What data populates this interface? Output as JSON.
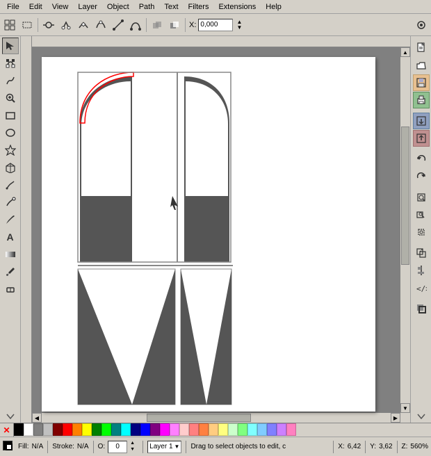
{
  "menubar": {
    "items": [
      "File",
      "Edit",
      "View",
      "Layer",
      "Object",
      "Path",
      "Text",
      "Filters",
      "Extensions",
      "Help"
    ]
  },
  "toolbar": {
    "x_label": "X:",
    "x_value": "0,000",
    "icons": [
      "select-all",
      "rubber-band",
      "node-join",
      "node-break",
      "node-cusp",
      "node-smooth",
      "node-symmetric",
      "node-auto-smooth",
      "segment-line",
      "segment-curve",
      "path-union",
      "path-difference"
    ],
    "snap_icons": [
      "snap-to-grid",
      "snap-enable"
    ]
  },
  "toolbox": {
    "tools": [
      {
        "name": "selector",
        "icon": "↖",
        "active": true
      },
      {
        "name": "node-editor",
        "icon": "⬡"
      },
      {
        "name": "tweak",
        "icon": "~"
      },
      {
        "name": "zoom",
        "icon": "🔍"
      },
      {
        "name": "rect",
        "icon": "▭"
      },
      {
        "name": "ellipse",
        "icon": "⬭"
      },
      {
        "name": "star",
        "icon": "★"
      },
      {
        "name": "3d-box",
        "icon": "◱"
      },
      {
        "name": "pencil",
        "icon": "✏"
      },
      {
        "name": "pen",
        "icon": "🖊"
      },
      {
        "name": "calligraphy",
        "icon": "⌇"
      },
      {
        "name": "text",
        "icon": "A"
      },
      {
        "name": "gradient",
        "icon": "◧"
      },
      {
        "name": "dropper",
        "icon": "💧"
      },
      {
        "name": "eraser",
        "icon": "⬜"
      }
    ]
  },
  "drawing": {
    "shapes": "arch-window-design",
    "fill_color": "#555555",
    "outline_color": "red",
    "background": "white"
  },
  "right_panel": {
    "icons": [
      "new-doc",
      "open-doc",
      "save-doc",
      "print",
      "sep",
      "import",
      "export",
      "sep2",
      "undo",
      "redo",
      "sep3",
      "zoom-fit",
      "zoom-draw",
      "zoom-sel",
      "sep4",
      "transform",
      "align",
      "xml-editor",
      "sep5",
      "fill-stroke"
    ]
  },
  "statusbar": {
    "fill_label": "Fill:",
    "fill_value": "N/A",
    "stroke_label": "Stroke:",
    "stroke_value": "N/A",
    "opacity_label": "O:",
    "opacity_value": "0",
    "layer_label": "Layer 1",
    "message": "Drag to select objects to edit, c",
    "x_label": "X:",
    "x_value": "6,42",
    "y_label": "Y:",
    "y_value": "3,62",
    "zoom_label": "Z:",
    "zoom_value": "560%"
  },
  "palette": {
    "colors": [
      "#000000",
      "#ffffff",
      "#808080",
      "#c0c0c0",
      "#800000",
      "#ff0000",
      "#ff8000",
      "#ffff00",
      "#008000",
      "#00ff00",
      "#008080",
      "#00ffff",
      "#000080",
      "#0000ff",
      "#800080",
      "#ff00ff",
      "#ff80ff",
      "#ffcccc",
      "#ff8080",
      "#ff8040",
      "#ffcc80",
      "#ffff80",
      "#ccffcc",
      "#80ff80",
      "#80ffff",
      "#80ccff",
      "#8080ff",
      "#cc80ff",
      "#ff80c0"
    ]
  }
}
